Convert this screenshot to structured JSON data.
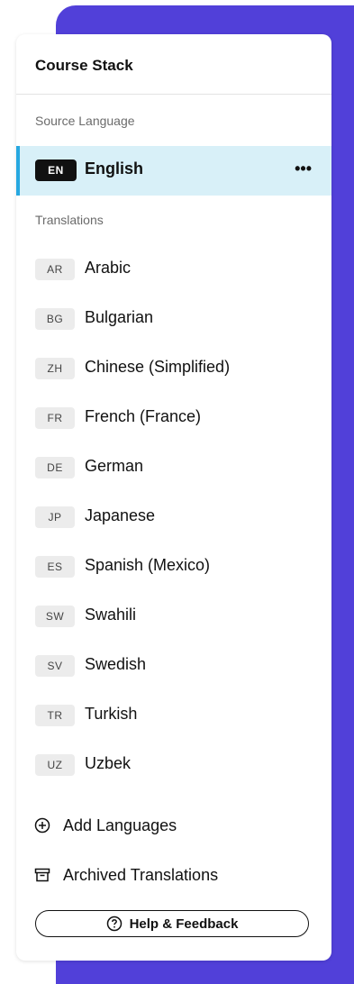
{
  "panel": {
    "title": "Course Stack"
  },
  "source": {
    "section_label": "Source Language",
    "code": "EN",
    "name": "English",
    "more_icon": "more-horizontal-icon"
  },
  "translations": {
    "section_label": "Translations",
    "items": [
      {
        "code": "AR",
        "name": "Arabic"
      },
      {
        "code": "BG",
        "name": "Bulgarian"
      },
      {
        "code": "ZH",
        "name": "Chinese (Simplified)"
      },
      {
        "code": "FR",
        "name": "French (France)"
      },
      {
        "code": "DE",
        "name": "German"
      },
      {
        "code": "JP",
        "name": "Japanese"
      },
      {
        "code": "ES",
        "name": "Spanish (Mexico)"
      },
      {
        "code": "SW",
        "name": "Swahili"
      },
      {
        "code": "SV",
        "name": "Swedish"
      },
      {
        "code": "TR",
        "name": "Turkish"
      },
      {
        "code": "UZ",
        "name": "Uzbek"
      }
    ]
  },
  "actions": {
    "add_languages": {
      "label": "Add Languages",
      "icon": "plus-circle-icon"
    },
    "archived": {
      "label": "Archived Translations",
      "icon": "archive-icon"
    }
  },
  "help": {
    "label": "Help & Feedback",
    "icon": "question-circle-icon"
  },
  "colors": {
    "backdrop": "#5140d9",
    "selected_row_bg": "#d8f0f8",
    "selected_accent": "#27a8e0"
  }
}
